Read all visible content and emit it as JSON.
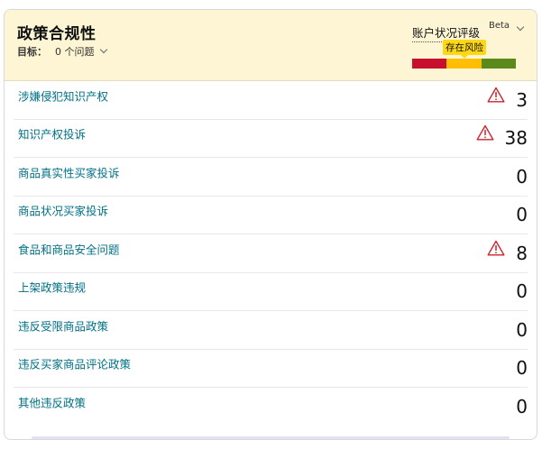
{
  "header": {
    "title": "政策合规性",
    "target_label": "目标：",
    "target_value": "0 个问题",
    "rating_title": "账户状况评级",
    "beta": "Beta",
    "risk_badge": "存在风险",
    "risk_bar_colors": [
      "#c7102e",
      "#ffbf00",
      "#5c8a1a"
    ]
  },
  "colors": {
    "warning": "#d0212b",
    "link": "#007185",
    "header_bg": "#fdf5d3"
  },
  "rows": [
    {
      "label": "涉嫌侵犯知识产权",
      "count": "3",
      "warning": true
    },
    {
      "label": "知识产权投诉",
      "count": "38",
      "warning": true
    },
    {
      "label": "商品真实性买家投诉",
      "count": "0",
      "warning": false
    },
    {
      "label": "商品状况买家投诉",
      "count": "0",
      "warning": false
    },
    {
      "label": "食品和商品安全问题",
      "count": "8",
      "warning": true
    },
    {
      "label": "上架政策违规",
      "count": "0",
      "warning": false
    },
    {
      "label": "违反受限商品政策",
      "count": "0",
      "warning": false
    },
    {
      "label": "违反买家商品评论政策",
      "count": "0",
      "warning": false
    },
    {
      "label": "其他违反政策",
      "count": "0",
      "warning": false
    }
  ]
}
